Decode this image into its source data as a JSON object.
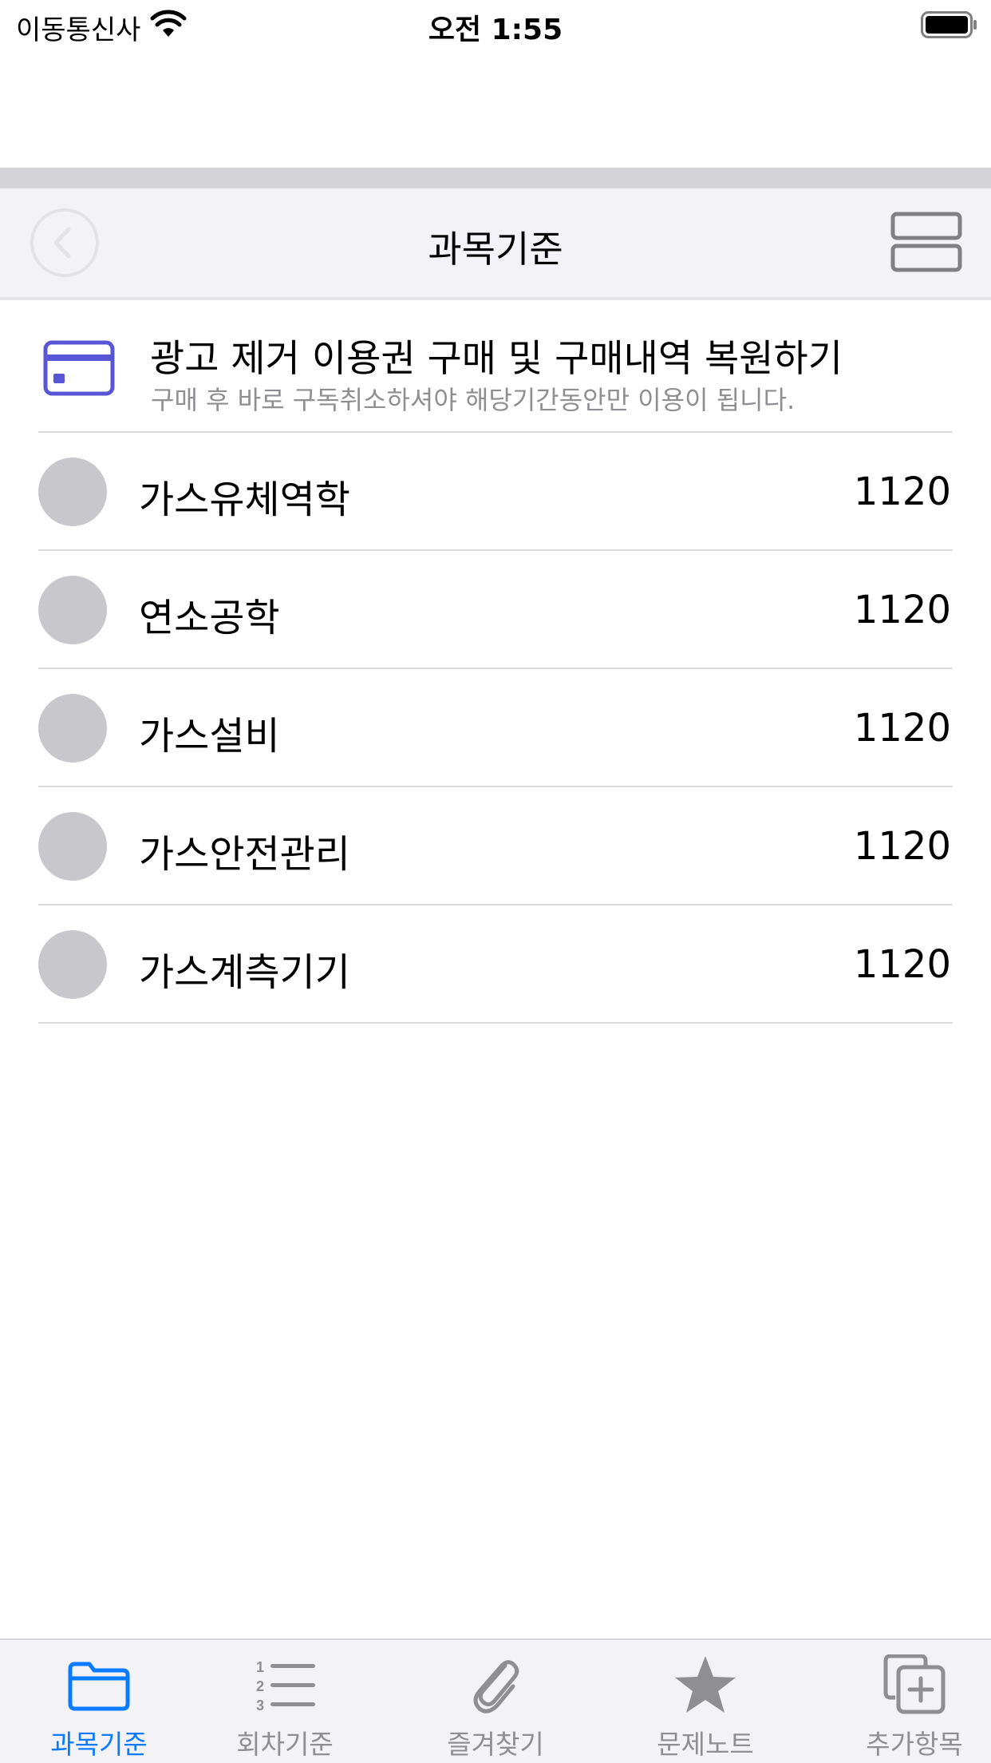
{
  "status_bar": {
    "carrier": "이동통신사",
    "time": "오전 1:55"
  },
  "nav": {
    "title": "과목기준"
  },
  "ad_banner": {
    "title": "광고 제거 이용권 구매 및 구매내역 복원하기",
    "subtitle": "구매 후 바로 구독취소하셔야 해당기간동안만 이용이 됩니다."
  },
  "subjects": [
    {
      "name": "가스유체역학",
      "count": "1120"
    },
    {
      "name": "연소공학",
      "count": "1120"
    },
    {
      "name": "가스설비",
      "count": "1120"
    },
    {
      "name": "가스안전관리",
      "count": "1120"
    },
    {
      "name": "가스계측기기",
      "count": "1120"
    }
  ],
  "tabs": [
    {
      "label": "과목기준",
      "icon": "folder-icon",
      "active": true
    },
    {
      "label": "회차기준",
      "icon": "numbered-list-icon",
      "active": false
    },
    {
      "label": "즐겨찾기",
      "icon": "paperclip-icon",
      "active": false
    },
    {
      "label": "문제노트",
      "icon": "star-icon",
      "active": false
    },
    {
      "label": "추가항목",
      "icon": "add-copy-icon",
      "active": false
    }
  ],
  "colors": {
    "accent": "#0a7aff",
    "card_icon": "#5856d6",
    "inactive": "#8e8e93",
    "dot": "#c7c7cc"
  }
}
